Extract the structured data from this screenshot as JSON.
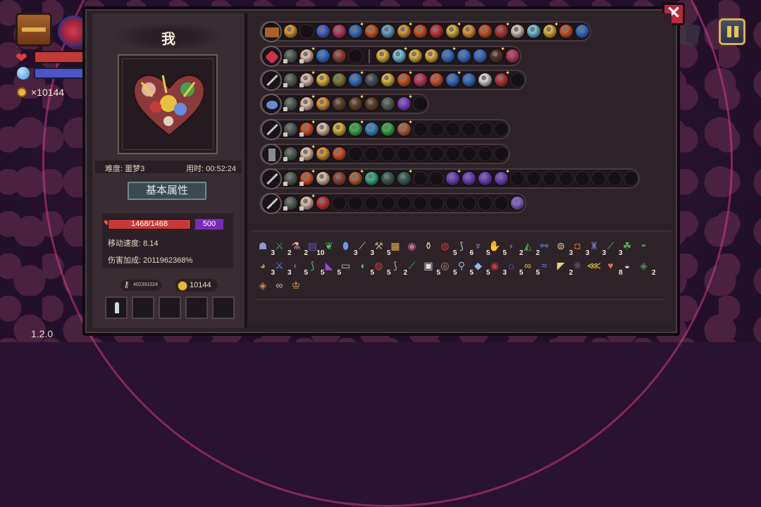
{
  "hud": {
    "gold": "×10144",
    "version": "1.2.0"
  },
  "panel": {
    "player_name": "我",
    "difficulty": "难度: 噩梦3",
    "play_time": "用时: 00:52:24",
    "attr_title": "基本属性",
    "hp": "1468/1468",
    "shield": "500",
    "move_speed": "移动速度: 8.14",
    "damage_bonus": "伤害加成: 2011962368%",
    "key_id": "402391024",
    "gold": "10144",
    "close_label": "✕"
  },
  "weapon_rows": [
    {
      "type": "chest",
      "icons": [
        "#e8a23a",
        "#141014",
        "#4a6ae0",
        "#d23b6a",
        "#3a7ad8",
        "#e0602a",
        "#6ab0d8",
        "#e8a23a",
        "#e05a2a",
        "#d43a3a",
        "#e0c040",
        "#e8a23a",
        "#e05a2a",
        "#c83a3a",
        "#e0d0c0",
        "#7ad0e8",
        "#e8c040",
        "#e05a2a",
        "#3a7ad8"
      ]
    },
    {
      "type": "gem",
      "icons": [
        "#5a6a5e",
        "#e8c8b0",
        "#3a7ad8",
        "#a04a3a",
        "#141014",
        "sep",
        "#e8c040",
        "#7ad0e8",
        "#e8c040",
        "#e8c040",
        "#3a7ad8",
        "#3a7ad8",
        "#3a7ad8",
        "#5a3a2a",
        "#d23b6a"
      ]
    },
    {
      "type": "sword",
      "icons": [
        "#5a6a5e",
        "#e8c8b0",
        "#e8c040",
        "#8a8a3a",
        "#3a7ad8",
        "#4a5a60",
        "#e8c040",
        "#e05a2a",
        "#d23b6a",
        "#e05a2a",
        "#3a7ad8",
        "#3a7ad8",
        "#e0e0e0",
        "#c83a3a",
        "#141014"
      ]
    },
    {
      "type": "shell",
      "icons": [
        "#5a6a5e",
        "#e8c8b0",
        "#e8a23a",
        "#6a4a2a",
        "#6a4a2a",
        "#6a4a2a",
        "#5a6a5e",
        "#8a4ae0",
        "#141014"
      ]
    },
    {
      "type": "sword",
      "icons": [
        "#5a6a5e",
        "#e05a2a",
        "#e8c8b0",
        "#e8c040",
        "#3ac04a",
        "#3a9ad8",
        "#3ac04a",
        "#c06a3a",
        "#141014",
        "#141014",
        "#141014",
        "#141014",
        "#141014",
        "#141014"
      ]
    },
    {
      "type": "hammer",
      "icons": [
        "#5a6a5e",
        "#e8c8b0",
        "#e8a23a",
        "#e05a2a",
        "#141014",
        "#141014",
        "#141014",
        "#141014",
        "#141014",
        "#141014",
        "#141014",
        "#141014",
        "#141014",
        "#141014"
      ]
    },
    {
      "type": "sword",
      "icons": [
        "#5a6a5e",
        "#e05a2a",
        "#e8c8b0",
        "#a04a3a",
        "#c06a3a",
        "#3ac08a",
        "#3a6a5a",
        "#3a6a5a",
        "#141014",
        "#141014",
        "#7a4ad8",
        "#7a4ad8",
        "#7a4ad8",
        "#7a4ad8",
        "#141014",
        "#141014",
        "#141014",
        "#141014",
        "#141014",
        "#141014",
        "#141014",
        "#141014"
      ]
    },
    {
      "type": "sword",
      "icons": [
        "#5a6a5e",
        "#e8c8b0",
        "#d23b3a",
        "#141014",
        "#141014",
        "#141014",
        "#141014",
        "#141014",
        "#141014",
        "#141014",
        "#141014",
        "#141014",
        "#141014",
        "#141014",
        "#8a6ae0"
      ]
    }
  ],
  "items": [
    {
      "c": "#8a9ad8",
      "g": "☗",
      "n": "3"
    },
    {
      "c": "#4aa04a",
      "g": "⚔",
      "n": "2"
    },
    {
      "c": "#e0b0a0",
      "g": "⚗",
      "n": "2"
    },
    {
      "c": "#6a5ab8",
      "g": "▤",
      "n": "10"
    },
    {
      "c": "#4ac04a",
      "g": "❦",
      "n": ""
    },
    {
      "c": "#6a9ae8",
      "g": "⬮",
      "n": "3"
    },
    {
      "c": "#e0c0b0",
      "g": "⟋",
      "n": "3"
    },
    {
      "c": "#c0a080",
      "g": "⚒",
      "n": "5"
    },
    {
      "c": "#e8b040",
      "g": "▦",
      "n": ""
    },
    {
      "c": "#d07090",
      "g": "◉",
      "n": ""
    },
    {
      "c": "#e0d0a0",
      "g": "⚱",
      "n": ""
    },
    {
      "c": "#d03a3a",
      "g": "◍",
      "n": "5"
    },
    {
      "c": "#c0c0c0",
      "g": "⟆",
      "n": "6"
    },
    {
      "c": "#a0a0e0",
      "g": "♆",
      "n": "5"
    },
    {
      "c": "#4ac04a",
      "g": "✋",
      "n": "5"
    },
    {
      "c": "#6a5a6a",
      "g": "◗",
      "n": "2"
    },
    {
      "c": "#4aa04a",
      "g": "◭",
      "n": "2"
    },
    {
      "c": "#6a8ae8",
      "g": "⚯",
      "n": ""
    },
    {
      "c": "#e0d0a0",
      "g": "⊚",
      "n": "3"
    },
    {
      "c": "#c05a3a",
      "g": "◘",
      "n": "3"
    },
    {
      "c": "#6a6aa8",
      "g": "♜",
      "n": "3"
    },
    {
      "c": "#4ac06a",
      "g": "⟋",
      "n": "3"
    },
    {
      "c": "#4ac04a",
      "g": "☘",
      "n": ""
    },
    {
      "c": "#4aa04a",
      "g": "◓",
      "n": ""
    },
    {
      "c": "#c08a4a",
      "g": "◕",
      "n": "3"
    },
    {
      "c": "#5a8ae8",
      "g": "⚔",
      "n": "3"
    },
    {
      "c": "#5a5a6a",
      "g": "◐",
      "n": "5"
    },
    {
      "c": "#4ac08a",
      "g": "⟆",
      "n": "5"
    },
    {
      "c": "#a04ad8",
      "g": "◣",
      "n": "5"
    },
    {
      "c": "#c0c0c0",
      "g": "▭",
      "n": ""
    },
    {
      "c": "#4ac06a",
      "g": "◖",
      "n": "5"
    },
    {
      "c": "#d03a3a",
      "g": "◍",
      "n": "5"
    },
    {
      "c": "#c0a0a0",
      "g": "⟆",
      "n": "2"
    },
    {
      "c": "#4ac04a",
      "g": "⟋",
      "n": ""
    },
    {
      "c": "#e0e0e0",
      "g": "▣",
      "n": "5"
    },
    {
      "c": "#c08a6a",
      "g": "◎",
      "n": "5"
    },
    {
      "c": "#a0b0c0",
      "g": "⚲",
      "n": "5"
    },
    {
      "c": "#8ac0e8",
      "g": "◆",
      "n": "5"
    },
    {
      "c": "#d03a3a",
      "g": "◉",
      "n": "3"
    },
    {
      "c": "#8a4ad8",
      "g": "⌂",
      "n": "5"
    },
    {
      "c": "#e8c040",
      "g": "∞",
      "n": "5"
    },
    {
      "c": "#6a8ae8",
      "g": "≈",
      "n": ""
    },
    {
      "c": "#e8d080",
      "g": "◤",
      "n": "2"
    },
    {
      "c": "#5a4a5a",
      "g": "✺",
      "n": ""
    },
    {
      "c": "#e8c040",
      "g": "⋘",
      "n": ""
    },
    {
      "c": "#e86a4a",
      "g": "♥",
      "n": "8"
    },
    {
      "c": "#d0d0d0",
      "g": "◒",
      "n": ""
    },
    {
      "c": "#4a8a5a",
      "g": "◈",
      "n": "2"
    },
    {
      "c": "#c08a4a",
      "g": "◈",
      "n": ""
    },
    {
      "c": "#c0c0c0",
      "g": "∞",
      "n": ""
    },
    {
      "c": "#e8b040",
      "g": "♔",
      "n": ""
    }
  ]
}
